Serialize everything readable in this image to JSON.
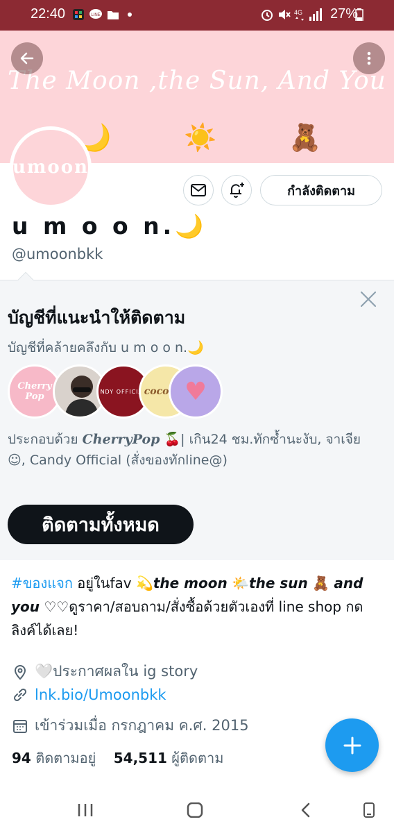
{
  "status_bar": {
    "time": "22:40",
    "notification_icons": [
      "grid-app-icon",
      "line-icon",
      "folder-icon",
      "dot-icon"
    ],
    "system_icons": [
      "alarm-icon",
      "mute-icon",
      "4g-icon",
      "signal-icon"
    ],
    "battery": "27%"
  },
  "banner": {
    "script_text": "The Moon ,the Sun, And You",
    "emojis": [
      "🌙",
      "☀️",
      "🧸"
    ],
    "color": "#fdd5d9"
  },
  "profile": {
    "avatar_text": "umoon",
    "display_name": "u m o o n.",
    "name_emoji": "🌙",
    "handle": "@umoonbkk",
    "following_button": "กำลังติดตาม"
  },
  "suggestions": {
    "title": "บัญชีที่แนะนำให้ติดตาม",
    "subtitle": "บัญชีที่คล้ายคลึงกับ u m o o n.🌙",
    "avatars": [
      {
        "label": "Cherry Pop",
        "bg": "#f7b9c8",
        "fg": "#ffffff"
      },
      {
        "label": "",
        "bg": "#d9d2cc",
        "fg": "#222222"
      },
      {
        "label": "NDY OFFICIAL",
        "bg": "#8a1420",
        "fg": "#ffffff"
      },
      {
        "label": "coconut",
        "bg": "#f5e7a8",
        "fg": "#8a5a2b"
      },
      {
        "label": "♥",
        "bg": "#b9a7e8",
        "fg": "#f07a9a"
      }
    ],
    "desc_prefix": "ประกอบด้วย ",
    "desc_bold": "CherryPop",
    "desc_rest": " 🍒| เกิน24 ชม.ทักซ้ำนะงับ, จาเจีย ☺, Candy Official (สั่งของทักline@)",
    "follow_all_button": "ติดตามทั้งหมด"
  },
  "bio": {
    "hashtag": "#ของแจก",
    "text1": " อยู่ในfav 💫",
    "em1": "the moon",
    "text2": " 🌤️",
    "em2": "the sun",
    "text3": " 🧸 ",
    "em3": "and you",
    "text4": " ♡♡ดูราคา/สอบถาม/สั่งซื้อด้วยตัวเองที่ line shop กดลิงค์ได้เลย!"
  },
  "meta": {
    "location": "🤍ประกาศผลใน ig story",
    "link": "lnk.bio/Umoonbkk",
    "joined": "เข้าร่วมเมื่อ กรกฎาคม ค.ศ. 2015"
  },
  "counts": {
    "following_count": "94",
    "following_label": " ติดตามอยู่",
    "followers_count": "54,511",
    "followers_label": " ผู้ติดตาม"
  },
  "colors": {
    "status_bar": "#8c2a33",
    "accent": "#1d9bf0",
    "banner": "#fdd5d9"
  }
}
